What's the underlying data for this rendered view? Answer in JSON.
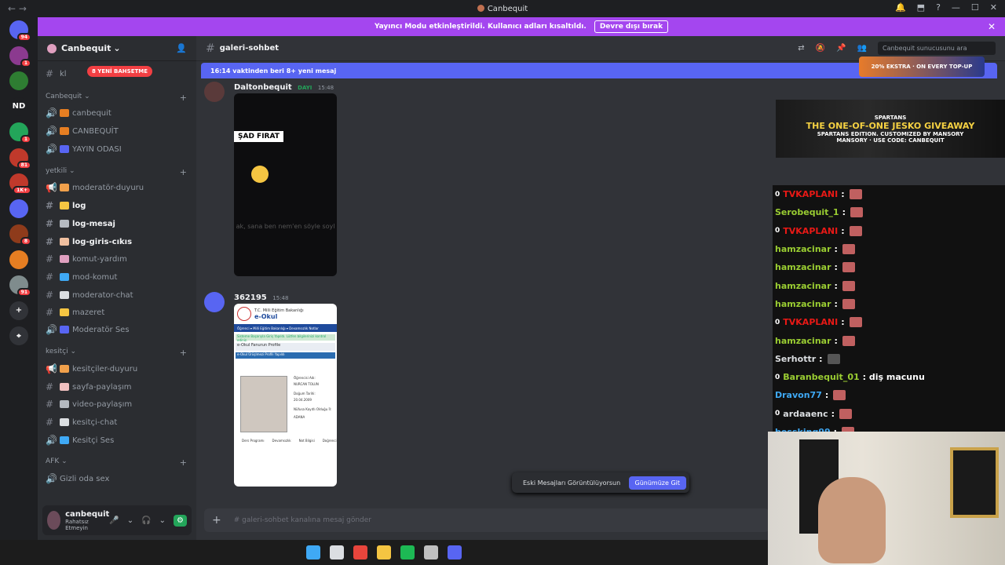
{
  "window": {
    "title": "Canbequit",
    "nav_back": "←",
    "nav_forward": "→",
    "controls": [
      "🔔",
      "⬒",
      "?",
      "—",
      "☐",
      "✕"
    ]
  },
  "banner": {
    "text": "Yayıncı Modu etkinleştirildi. Kullanıcı adları kısaltıldı.",
    "button": "Devre dışı bırak",
    "close": "✕"
  },
  "guilds": [
    {
      "label": "",
      "color": "#5865f2",
      "badge": "94"
    },
    {
      "label": "",
      "color": "#8b3a8f",
      "badge": "1"
    },
    {
      "label": "",
      "color": "#2e7d32",
      "badge": ""
    },
    {
      "label": "ND",
      "color": "#1e1f22",
      "badge": ""
    },
    {
      "label": "",
      "color": "#23a55a",
      "badge": "1"
    },
    {
      "label": "",
      "color": "#c0392b",
      "badge": "81"
    },
    {
      "label": "",
      "color": "#c0392b",
      "badge": "1K+"
    },
    {
      "label": "",
      "color": "#5865f2",
      "badge": ""
    },
    {
      "label": "",
      "color": "#8e3b1b",
      "badge": "8"
    },
    {
      "label": "",
      "color": "#e67e22",
      "badge": ""
    },
    {
      "label": "",
      "color": "#7f8c8d",
      "badge": "91"
    },
    {
      "label": "+",
      "color": "#313338",
      "badge": ""
    },
    {
      "label": "⌖",
      "color": "#313338",
      "badge": ""
    }
  ],
  "server": {
    "name": "Canbequit",
    "chevron": "⌄",
    "unread_pill": "8 YENİ BAHSETME",
    "partial_channel": "kl"
  },
  "categories": [
    {
      "name": "Canbequit",
      "plus": "+"
    },
    {
      "name": "yetkili",
      "plus": "+"
    },
    {
      "name": "kesitçi",
      "plus": "+"
    },
    {
      "name": "AFK",
      "plus": "+"
    }
  ],
  "channels": [
    {
      "name": "canbequit",
      "icon": "🔊",
      "emoji_color": "#e67e22"
    },
    {
      "name": "CANBEQUİT",
      "icon": "🔊",
      "emoji_color": "#e67e22"
    },
    {
      "name": "YAYIN ODASI",
      "icon": "🔊",
      "emoji_color": "#5865f2"
    },
    {
      "name": "moderatör-duyuru",
      "icon": "📢",
      "emoji_color": "#f0a04b"
    },
    {
      "name": "log",
      "icon": "#",
      "emoji_color": "#f5c542"
    },
    {
      "name": "log-mesaj",
      "icon": "#",
      "emoji_color": "#b5bac1"
    },
    {
      "name": "log-giris-cıkıs",
      "icon": "#",
      "emoji_color": "#f0c0a0"
    },
    {
      "name": "komut-yardım",
      "icon": "#",
      "emoji_color": "#e0a0c0"
    },
    {
      "name": "mod-komut",
      "icon": "#",
      "emoji_color": "#3fa9f5"
    },
    {
      "name": "moderator-chat",
      "icon": "#",
      "emoji_color": "#dbdee1"
    },
    {
      "name": "mazeret",
      "icon": "#",
      "emoji_color": "#f5c542"
    },
    {
      "name": "Moderatör Ses",
      "icon": "🔊",
      "emoji_color": "#5865f2"
    },
    {
      "name": "kesitçiler-duyuru",
      "icon": "📢",
      "emoji_color": "#f0a04b"
    },
    {
      "name": "sayfa-paylaşım",
      "icon": "#",
      "emoji_color": "#f0c0c0"
    },
    {
      "name": "video-paylaşım",
      "icon": "#",
      "emoji_color": "#b5bac1"
    },
    {
      "name": "kesitçi-chat",
      "icon": "#",
      "emoji_color": "#dbdee1"
    },
    {
      "name": "Kesitçi Ses",
      "icon": "🔊",
      "emoji_color": "#3fa9f5"
    },
    {
      "name": "Gizli oda sex",
      "icon": "🔊",
      "emoji_color": ""
    }
  ],
  "user": {
    "name": "canbequit",
    "status": "Rahatsız Etmeyin",
    "icons": [
      "🎤",
      "⌄",
      "🎧",
      "⌄",
      "⚙"
    ]
  },
  "header": {
    "channel": "galeri-sohbet",
    "search_placeholder": "Canbequit sunucusunu ara",
    "tool_icons": [
      "⇄",
      "🔕",
      "📌",
      "👥"
    ]
  },
  "new_messages": "16:14 vaktinden beri 8+ yeni mesaj",
  "messages": [
    {
      "author": "Daltonbequit",
      "role": "DAYI",
      "time": "15:48",
      "media_caption": "ŞAD FIRAT",
      "media_sub": "ak, sana ben nem'en söyle soyl"
    },
    {
      "author": "362195",
      "role": "",
      "time": "15:48",
      "doc": {
        "ministry": "T.C. Milli Eğitim Bakanlığı",
        "title": "e-Okul",
        "nav": "Öğrenci ▾   Milli Eğitim Bakanlığı ▾   Devamsızlık   Notlar",
        "notice": "Sisteme Başarıyla Giriş Yapıldı. Lütfen bilgilerinizi kontrol ediniz.",
        "section": "e-Okul Fanurun Profile",
        "profile_bar": "e-Okul Ürüşlmezi Profili Yapıldı",
        "student_label": "Öğrencisi Adı:",
        "student_name": "NURCAN TOLUN",
        "birth_label": "Doğum Tarihi:",
        "birth": "20.04.2009",
        "place_label": "Nüfusa Kayıtlı Olduğu İl:",
        "place": "ADANA",
        "tabs": [
          "Ders Programı",
          "Devamsızlık",
          "Not Bilgisi",
          "Doğrenci"
        ]
      }
    }
  ],
  "old_messages": {
    "text": "Eski Mesajları Görüntülüyorsun",
    "button": "Günümüze Git"
  },
  "composer": {
    "placeholder": "galeri-sohbet kanalına mesaj gönder",
    "plus": "+"
  },
  "ads": {
    "top": "20% EKSTRA · ON EVERY TOP-UP",
    "brand": "SPARTANS",
    "headline": "THE ONE-OF-ONE JESKO GIVEAWAY",
    "sub": "SPARTANS EDITION. CUSTOMIZED BY MANSORY",
    "code": "MANSORY · USE CODE: CANBEQUIT"
  },
  "chat": [
    {
      "user": "TVKAPLANI",
      "color": "#e91916",
      "zero": true,
      "text": ":",
      "emote": "red"
    },
    {
      "user": "Serobequit_1",
      "color": "#9acd32",
      "zero": false,
      "text": ":",
      "emote": "red"
    },
    {
      "user": "TVKAPLANI",
      "color": "#e91916",
      "zero": true,
      "text": ":",
      "emote": "red"
    },
    {
      "user": "hamzacinar",
      "color": "#9acd32",
      "zero": false,
      "text": ":",
      "emote": "red"
    },
    {
      "user": "hamzacinar",
      "color": "#9acd32",
      "zero": false,
      "text": ":",
      "emote": "red"
    },
    {
      "user": "hamzacinar",
      "color": "#9acd32",
      "zero": false,
      "text": ":",
      "emote": "red"
    },
    {
      "user": "hamzacinar",
      "color": "#9acd32",
      "zero": false,
      "text": ":",
      "emote": "red"
    },
    {
      "user": "TVKAPLANI",
      "color": "#e91916",
      "zero": true,
      "text": ":",
      "emote": "red"
    },
    {
      "user": "hamzacinar",
      "color": "#9acd32",
      "zero": false,
      "text": ":",
      "emote": "red"
    },
    {
      "user": "Serhottr",
      "color": "#dbdee1",
      "zero": false,
      "text": ":",
      "emote": "dark"
    },
    {
      "user": "Baranbequit_01",
      "color": "#9acd32",
      "zero": true,
      "text": ": diş macunu",
      "emote": ""
    },
    {
      "user": "Dravon77",
      "color": "#3fa9f5",
      "zero": false,
      "text": ":",
      "emote": "red"
    },
    {
      "user": "ardaaenc",
      "color": "#dbdee1",
      "zero": true,
      "text": ":",
      "emote": "red"
    },
    {
      "user": "bossking99",
      "color": "#3fa9f5",
      "zero": false,
      "text": ":",
      "emote": "red"
    }
  ],
  "taskbar": {
    "icons": [
      {
        "name": "windows-start-icon",
        "color": "#3fa9f5"
      },
      {
        "name": "search-icon",
        "color": "#dbdee1"
      },
      {
        "name": "chrome-icon",
        "color": "#e8453c"
      },
      {
        "name": "file-explorer-icon",
        "color": "#f5c542"
      },
      {
        "name": "spotify-icon",
        "color": "#1db954"
      },
      {
        "name": "steam-icon",
        "color": "#c0c0c0"
      },
      {
        "name": "discord-icon",
        "color": "#5865f2"
      }
    ]
  }
}
